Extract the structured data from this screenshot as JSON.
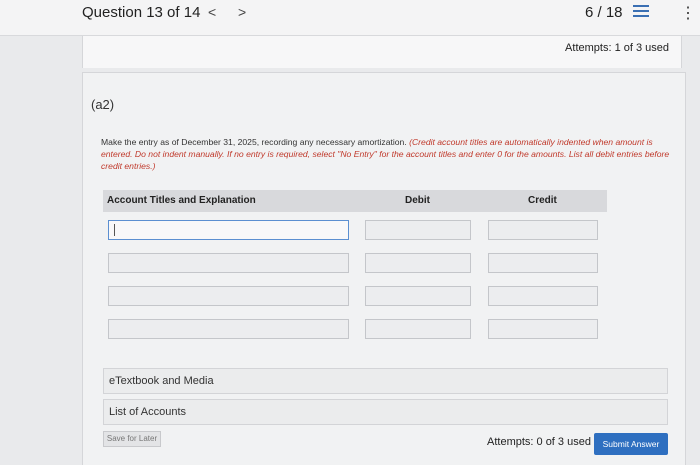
{
  "header": {
    "question_label": "Question 13 of 14",
    "prev_symbol": "<",
    "next_symbol": ">",
    "progress": "6 / 18",
    "more_symbol": "⋮"
  },
  "attempts_top": "Attempts: 1 of 3 used",
  "part_label": "(a2)",
  "instructions": {
    "main": "Make the entry as of December 31, 2025, recording any necessary amortization. ",
    "note": "(Credit account titles are automatically indented when amount is entered. Do not indent manually. If no entry is required, select \"No Entry\" for the account titles and enter 0 for the amounts. List all debit entries before credit entries.)"
  },
  "table": {
    "headers": {
      "account": "Account Titles and Explanation",
      "debit": "Debit",
      "credit": "Credit"
    },
    "rows": [
      {
        "account": "",
        "debit": "",
        "credit": ""
      },
      {
        "account": "",
        "debit": "",
        "credit": ""
      },
      {
        "account": "",
        "debit": "",
        "credit": ""
      },
      {
        "account": "",
        "debit": "",
        "credit": ""
      }
    ]
  },
  "resources": {
    "etextbook": "eTextbook and Media",
    "accounts": "List of Accounts"
  },
  "footer": {
    "save_label": "Save for Later",
    "attempts": "Attempts: 0 of 3 used",
    "submit_label": "Submit Answer"
  },
  "colors": {
    "accent": "#2e6fc0",
    "note_red": "#c0392b"
  }
}
